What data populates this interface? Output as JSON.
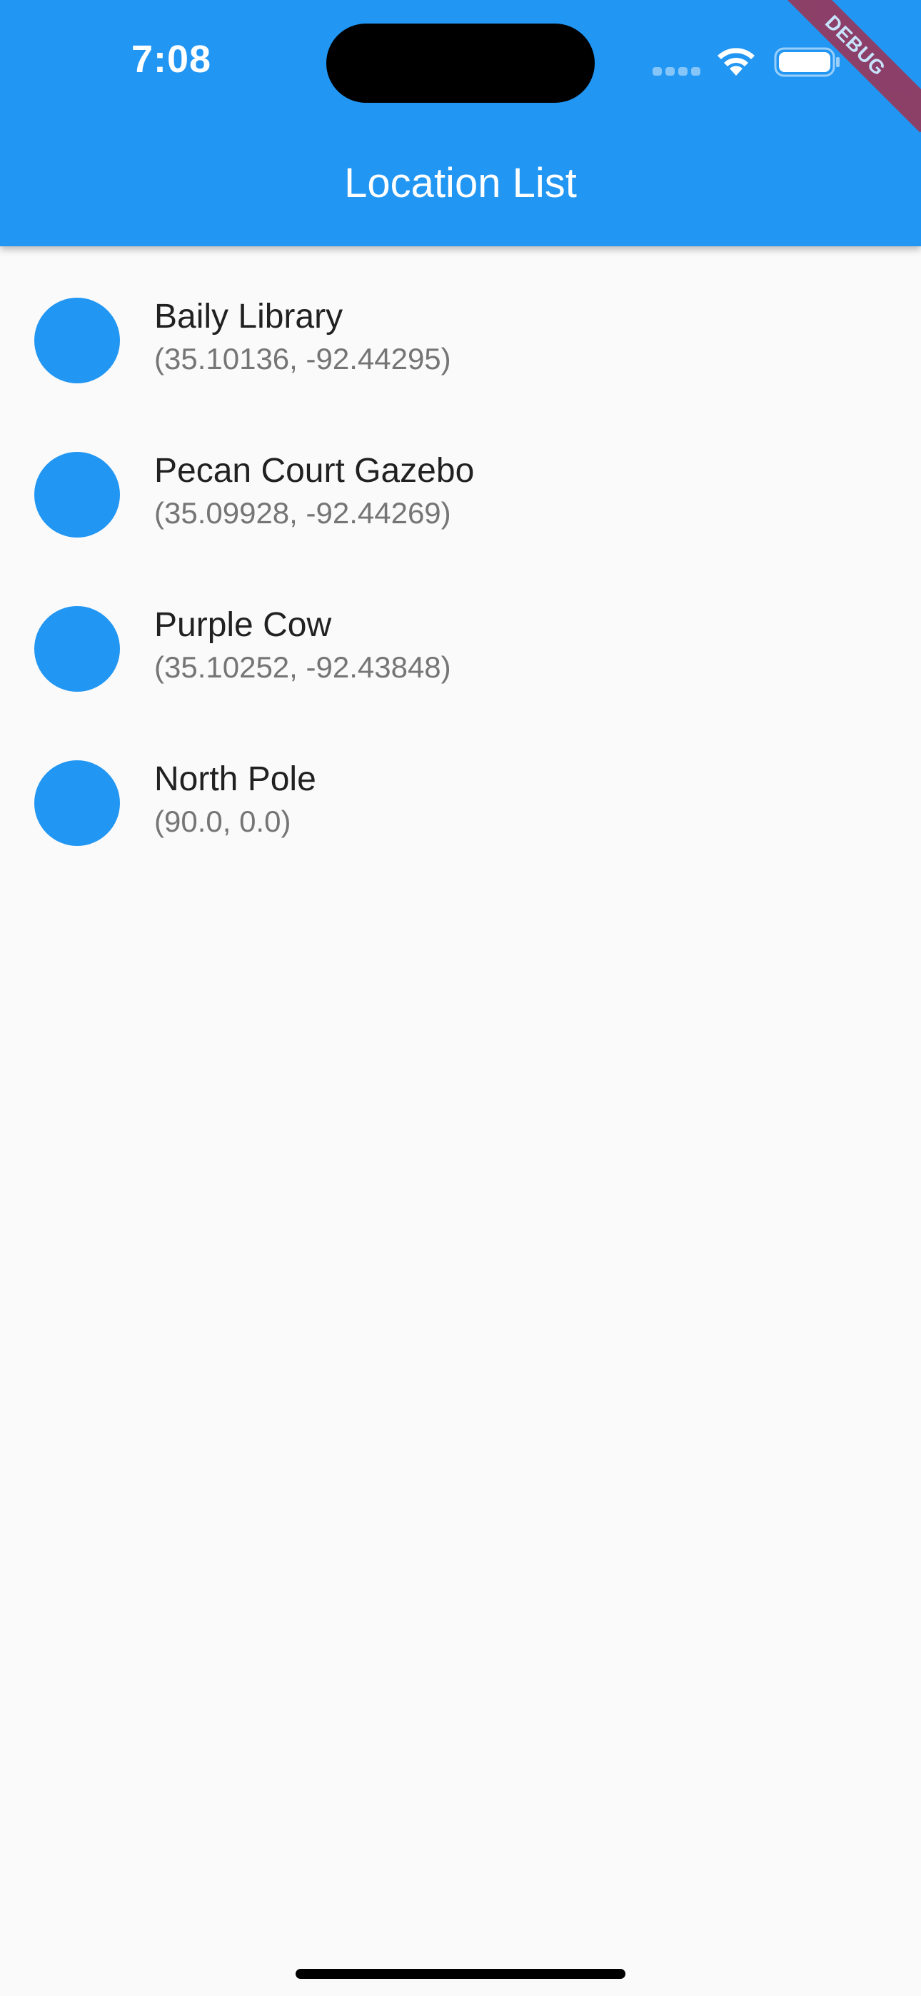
{
  "status_bar": {
    "time": "7:08",
    "wifi_icon": "wifi-icon",
    "battery_icon": "battery-icon"
  },
  "app_bar": {
    "title": "Location List",
    "color": "#2196f3"
  },
  "debug_banner": "DEBUG",
  "locations": [
    {
      "name": "Baily Library",
      "coords": "(35.10136, -92.44295)"
    },
    {
      "name": "Pecan Court Gazebo",
      "coords": "(35.09928, -92.44269)"
    },
    {
      "name": "Purple Cow",
      "coords": "(35.10252, -92.43848)"
    },
    {
      "name": "North Pole",
      "coords": "(90.0, 0.0)"
    }
  ]
}
